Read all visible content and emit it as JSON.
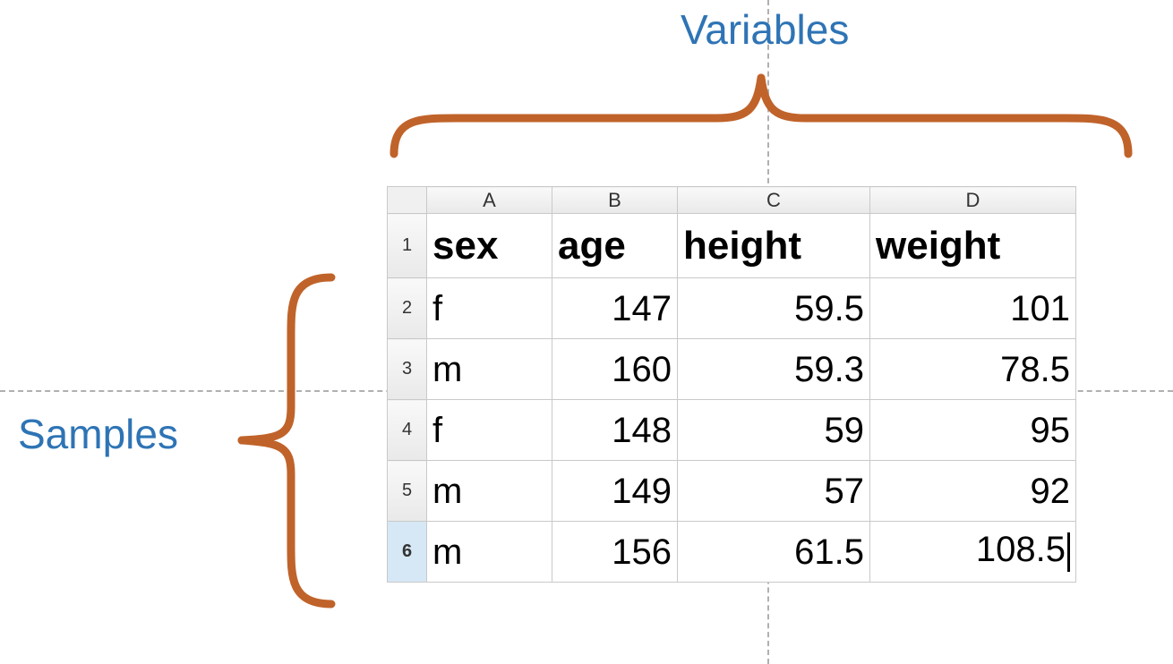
{
  "annotations": {
    "variables_label": "Variables",
    "samples_label": "Samples"
  },
  "spreadsheet": {
    "column_letters": [
      "A",
      "B",
      "C",
      "D"
    ],
    "row_numbers": [
      "1",
      "2",
      "3",
      "4",
      "5",
      "6"
    ],
    "active_row_index": 5,
    "headers": [
      "sex",
      "age",
      "height",
      "weight"
    ],
    "rows": [
      {
        "sex": "f",
        "age": "147",
        "height": "59.5",
        "weight": "101"
      },
      {
        "sex": "m",
        "age": "160",
        "height": "59.3",
        "weight": "78.5"
      },
      {
        "sex": "f",
        "age": "148",
        "height": "59",
        "weight": "95"
      },
      {
        "sex": "m",
        "age": "149",
        "height": "57",
        "weight": "92"
      },
      {
        "sex": "m",
        "age": "156",
        "height": "61.5",
        "weight": "108.5"
      }
    ]
  },
  "colors": {
    "brace": "#c0632a",
    "label": "#2e74b5",
    "dash": "#b0b0b0"
  }
}
